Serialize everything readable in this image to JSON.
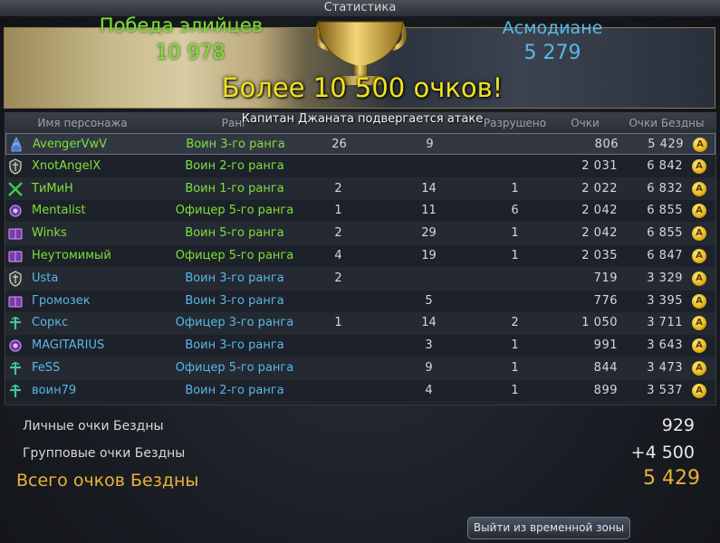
{
  "window": {
    "title": "Статистика"
  },
  "banner": {
    "elyos_label": "Победа элийцев",
    "elyos_score": "10 978",
    "asmo_label": "Асмодиане",
    "asmo_score": "5 279",
    "headline": "Более 10 500 очков!",
    "notice": "Капитан Джаната подвергается атаке"
  },
  "table": {
    "headers": {
      "name": "Имя персонажа",
      "rank": "Ранг",
      "destroyed": "Разрушено",
      "points": "Очки",
      "abyss": "Очки Бездны"
    },
    "rows": [
      {
        "icon": "ranger-icon",
        "name": "AvengerVwV",
        "rank": "Воин 3-го ранга",
        "kills": "26",
        "assists": "9",
        "destroyed": "",
        "points": "806",
        "abyss": "5 429",
        "style": "selected",
        "color": "green"
      },
      {
        "icon": "templar-icon",
        "name": "XnotAngelX",
        "rank": "Воин 2-го ранга",
        "kills": "",
        "assists": "",
        "destroyed": "",
        "points": "2 031",
        "abyss": "6 842",
        "style": "dark",
        "color": "green"
      },
      {
        "icon": "assassin-icon",
        "name": "ТиМиН",
        "rank": "Воин 1-го ранга",
        "kills": "2",
        "assists": "14",
        "destroyed": "1",
        "points": "2 022",
        "abyss": "6 832",
        "style": "light",
        "color": "green"
      },
      {
        "icon": "spiritmaster-icon",
        "name": "Mentalist",
        "rank": "Офицер 5-го ранга",
        "kills": "1",
        "assists": "11",
        "destroyed": "6",
        "points": "2 042",
        "abyss": "6 855",
        "style": "dark",
        "color": "green"
      },
      {
        "icon": "sorcerer-icon",
        "name": "Winks",
        "rank": "Воин 5-го ранга",
        "kills": "2",
        "assists": "29",
        "destroyed": "1",
        "points": "2 042",
        "abyss": "6 855",
        "style": "light",
        "color": "green"
      },
      {
        "icon": "sorcerer-icon",
        "name": "Неутомимый",
        "rank": "Офицер 5-го ранга",
        "kills": "4",
        "assists": "19",
        "destroyed": "1",
        "points": "2 035",
        "abyss": "6 847",
        "style": "dark",
        "color": "green"
      },
      {
        "icon": "templar-icon",
        "name": "Usta",
        "rank": "Воин 3-го ранга",
        "kills": "2",
        "assists": "",
        "destroyed": "",
        "points": "719",
        "abyss": "3 329",
        "style": "light",
        "color": "blue"
      },
      {
        "icon": "sorcerer-icon",
        "name": "Громозек",
        "rank": "Воин 3-го ранга",
        "kills": "",
        "assists": "5",
        "destroyed": "",
        "points": "776",
        "abyss": "3 395",
        "style": "dark",
        "color": "blue"
      },
      {
        "icon": "cleric-icon",
        "name": "Соркс",
        "rank": "Офицер 3-го ранга",
        "kills": "1",
        "assists": "14",
        "destroyed": "2",
        "points": "1 050",
        "abyss": "3 711",
        "style": "light",
        "color": "blue"
      },
      {
        "icon": "spiritmaster-icon",
        "name": "MAGITARIUS",
        "rank": "Воин 3-го ранга",
        "kills": "",
        "assists": "3",
        "destroyed": "1",
        "points": "991",
        "abyss": "3 643",
        "style": "dark",
        "color": "blue"
      },
      {
        "icon": "cleric-icon",
        "name": "FeSS",
        "rank": "Офицер 5-го ранга",
        "kills": "",
        "assists": "9",
        "destroyed": "1",
        "points": "844",
        "abyss": "3 473",
        "style": "light",
        "color": "blue"
      },
      {
        "icon": "cleric-icon",
        "name": "воин79",
        "rank": "Воин 2-го ранга",
        "kills": "",
        "assists": "4",
        "destroyed": "1",
        "points": "899",
        "abyss": "3 537",
        "style": "dark",
        "color": "blue"
      }
    ],
    "medal_letter": "A"
  },
  "summary": {
    "personal_label": "Личные очки Бездны",
    "personal_value": "929",
    "group_label": "Групповые очки Бездны",
    "group_value": "+4 500",
    "total_label": "Всего очков Бездны",
    "total_value": "5 429"
  },
  "buttons": {
    "exit": "Выйти из временной зоны"
  },
  "colors": {
    "elyos": "#7ee03a",
    "asmodian": "#58b8e8",
    "headline": "#f0e020",
    "total": "#e9b23a"
  }
}
